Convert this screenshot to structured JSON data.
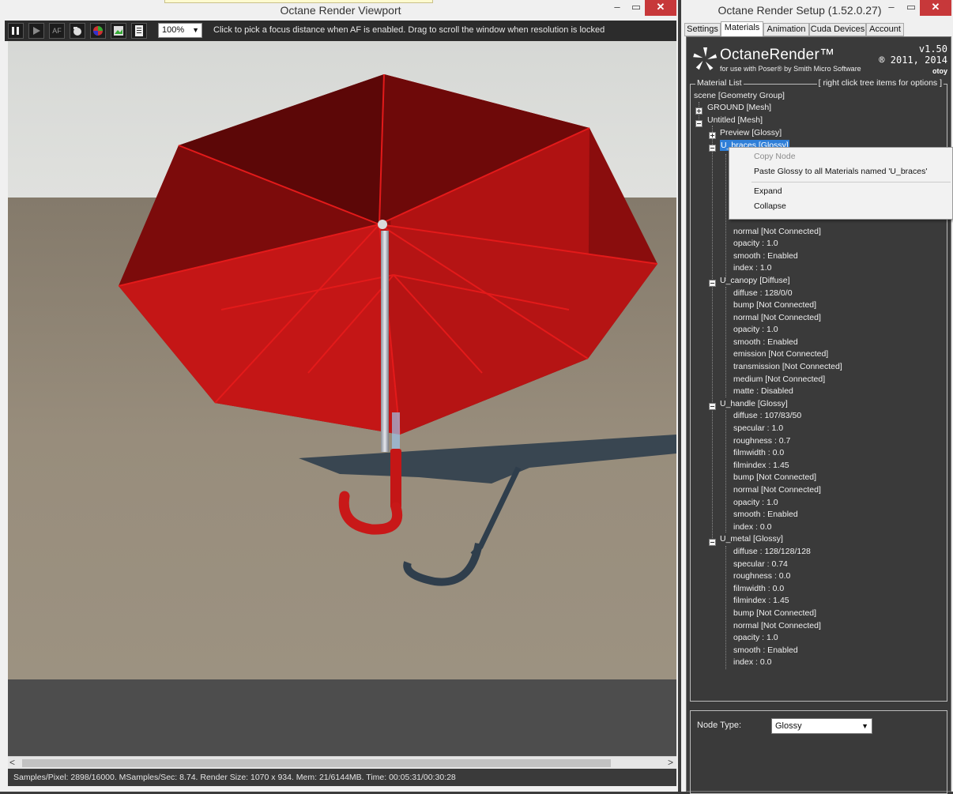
{
  "viewport": {
    "title": "Octane Render Viewport",
    "controls": {
      "minimize": "–",
      "maximize": "▭",
      "close": "✕"
    },
    "toolbar": {
      "pause_icon": "pause-icon",
      "play_icon": "play-icon",
      "af_label": "AF",
      "zoom_value": "100%",
      "hint": "Click to pick a focus distance when AF is enabled.  Drag to scroll the window when resolution is locked"
    },
    "scroll": {
      "left_arrow": "<",
      "right_arrow": ">"
    },
    "status": "Samples/Pixel: 2898/16000. MSamples/Sec: 8.74. Render Size: 1070 x 934. Mem: 21/6144MB. Time: 00:05:31/00:30:28"
  },
  "setup": {
    "title": "Octane Render Setup (1.52.0.27)",
    "controls": {
      "minimize": "–",
      "maximize": "▭",
      "close": "✕"
    },
    "tabs": [
      "Settings",
      "Materials",
      "Animation",
      "Cuda Devices",
      "Account"
    ],
    "active_tab": "Materials",
    "logo": {
      "name": "OctaneRender™",
      "subtitle": "for use with Poser® by Smith Micro Software",
      "version": "v1.50",
      "copyright": "® 2011, 2014",
      "brand": "otoy"
    },
    "material_list": {
      "legend": "Material List",
      "hint": "[ right click tree items for options ]",
      "tree": [
        "scene  [Geometry Group]",
        "GROUND  [Mesh]",
        "Untitled  [Mesh]",
        "Preview  [Glossy]",
        "U_braces  [Glossy]",
        "normal  [Not Connected]",
        "opacity  :  1.0",
        "smooth  :  Enabled",
        "index  :  1.0",
        "U_canopy  [Diffuse]",
        "diffuse  :  128/0/0",
        "bump  [Not Connected]",
        "normal  [Not Connected]",
        "opacity  :  1.0",
        "smooth  :  Enabled",
        "emission  [Not Connected]",
        "transmission  [Not Connected]",
        "medium  [Not Connected]",
        "matte  :  Disabled",
        "U_handle  [Glossy]",
        "diffuse  :  107/83/50",
        "specular  :  1.0",
        "roughness  :  0.7",
        "filmwidth  :  0.0",
        "filmindex  :  1.45",
        "bump  [Not Connected]",
        "normal  [Not Connected]",
        "opacity  :  1.0",
        "smooth  :  Enabled",
        "index  :  0.0",
        "U_metal  [Glossy]",
        "diffuse  :  128/128/128",
        "specular  :  0.74",
        "roughness  :  0.0",
        "filmwidth  :  0.0",
        "filmindex  :  1.45",
        "bump  [Not Connected]",
        "normal  [Not Connected]",
        "opacity  :  1.0",
        "smooth  :  Enabled",
        "index  :  0.0"
      ]
    },
    "context_menu": {
      "items": [
        "Copy Node",
        "Paste Glossy to all Materials named 'U_braces'",
        "Expand",
        "Collapse"
      ]
    },
    "node_type": {
      "label": "Node Type:",
      "value": "Glossy"
    }
  }
}
